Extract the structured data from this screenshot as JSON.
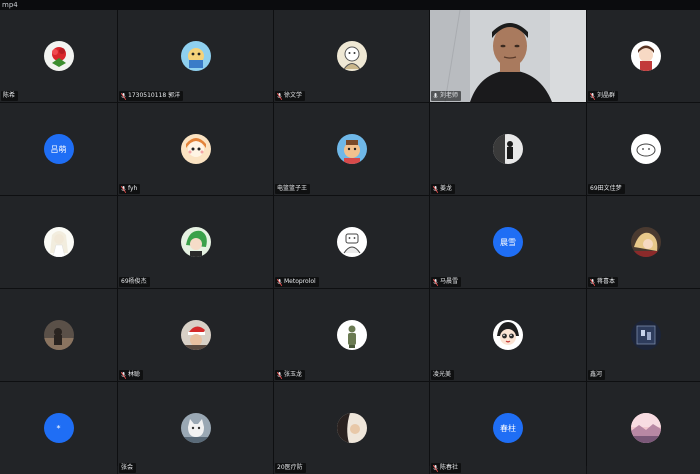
{
  "window": {
    "title": "mp4"
  },
  "colors": {
    "tile_bg": "#222427",
    "text_avatar": "#1f6ef5",
    "label_bg": "#000000"
  },
  "participants": [
    {
      "name": "陈希",
      "avatar": "red-flower-icon",
      "mic": false
    },
    {
      "name": "1730510118 郭洋",
      "avatar": "cartoon-avatar-icon",
      "mic": true
    },
    {
      "name": "徐文学",
      "avatar": "sketch-avatar-icon",
      "mic": true
    },
    {
      "name": "刘老师",
      "avatar": "live-video",
      "mic": true
    },
    {
      "name": "刘晶群",
      "avatar": "anime-girl-icon",
      "mic": true
    },
    {
      "name": "",
      "avatar_text": "吕萌",
      "mic": false
    },
    {
      "name": "fyh",
      "avatar": "cartoon-girl-icon",
      "mic": true
    },
    {
      "name": "电篮篮子王",
      "avatar": "cartoon-character-icon",
      "mic": false
    },
    {
      "name": "姜龙",
      "avatar": "dark-figure-icon",
      "mic": true
    },
    {
      "name": "69田文佳梦",
      "avatar": "white-blob-icon",
      "mic": false
    },
    {
      "name": "",
      "avatar": "white-bride-icon",
      "mic": false
    },
    {
      "name": "69杨俊杰",
      "avatar": "anime-green-icon",
      "mic": false
    },
    {
      "name": "Metoprolol",
      "avatar": "sketch-bear-icon",
      "mic": true
    },
    {
      "name": "马晨雪",
      "avatar_text": "晨雪",
      "mic": true
    },
    {
      "name": "蒋喜本",
      "avatar": "anime-hair-icon",
      "mic": true
    },
    {
      "name": "",
      "avatar": "dark-photo-icon",
      "mic": false
    },
    {
      "name": "林聪",
      "avatar": "santa-hat-icon",
      "mic": true
    },
    {
      "name": "张玉龙",
      "avatar": "green-person-icon",
      "mic": true
    },
    {
      "name": "凌光美",
      "avatar": "anime-face-icon",
      "mic": false
    },
    {
      "name": "鑫河",
      "avatar": "night-photo-icon",
      "mic": false
    },
    {
      "name": "",
      "avatar_text": "*",
      "mic": false
    },
    {
      "name": "张会",
      "avatar": "cat-icon",
      "mic": false
    },
    {
      "name": "20医疗防",
      "avatar": "beige-photo-icon",
      "mic": false
    },
    {
      "name": "陈春社",
      "avatar_text": "春柱",
      "mic": true
    },
    {
      "name": "",
      "avatar": "pink-landscape-icon",
      "mic": false
    }
  ]
}
